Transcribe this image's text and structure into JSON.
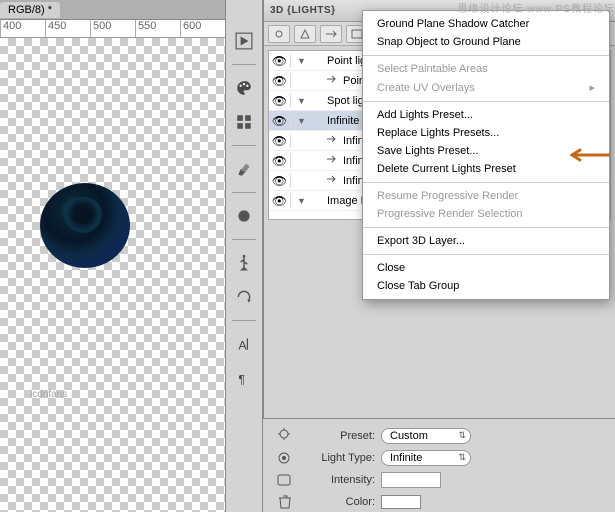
{
  "tab": {
    "title": "RGB/8) *"
  },
  "ruler": {
    "marks": [
      "400",
      "450",
      "500",
      "550",
      "600"
    ]
  },
  "panel": {
    "title": "3D {LIGHTS}"
  },
  "lights": [
    {
      "kind": "group",
      "label": "Point lights",
      "open": true,
      "selected": false
    },
    {
      "kind": "item",
      "label": "Point Li",
      "indent": 1
    },
    {
      "kind": "group",
      "label": "Spot lights",
      "open": true,
      "selected": false
    },
    {
      "kind": "group",
      "label": "Infinite lights",
      "open": true,
      "selected": true
    },
    {
      "kind": "item",
      "label": "Infinite",
      "indent": 1
    },
    {
      "kind": "item",
      "label": "Infinite",
      "indent": 1
    },
    {
      "kind": "item",
      "label": "Infinite",
      "indent": 1
    },
    {
      "kind": "group",
      "label": "Image Based",
      "open": true,
      "selected": false
    }
  ],
  "menu": {
    "items": [
      {
        "t": "Ground Plane Shadow Catcher",
        "en": true
      },
      {
        "t": "Snap Object to Ground Plane",
        "en": true
      },
      {
        "sep": true
      },
      {
        "t": "Select Paintable Areas",
        "en": false
      },
      {
        "t": "Create UV Overlays",
        "en": false,
        "sub": true
      },
      {
        "sep": true
      },
      {
        "t": "Add Lights Preset...",
        "en": true
      },
      {
        "t": "Replace Lights Presets...",
        "en": true,
        "arrow": true
      },
      {
        "t": "Save Lights Preset...",
        "en": true
      },
      {
        "t": "Delete Current Lights Preset",
        "en": true
      },
      {
        "sep": true
      },
      {
        "t": "Resume Progressive Render",
        "en": false
      },
      {
        "t": "Progressive Render Selection",
        "en": false
      },
      {
        "sep": true
      },
      {
        "t": "Export 3D Layer...",
        "en": true
      },
      {
        "sep": true
      },
      {
        "t": "Close",
        "en": true
      },
      {
        "t": "Close Tab Group",
        "en": true
      }
    ]
  },
  "bottom": {
    "preset_label": "Preset:",
    "preset_value": "Custom",
    "lighttype_label": "Light Type:",
    "lighttype_value": "Infinite",
    "intensity_label": "Intensity:",
    "color_label": "Color:"
  },
  "watermarks": {
    "top": "思缘设计论坛  www  PS教程论坛",
    "bottom": "icdnfans"
  }
}
